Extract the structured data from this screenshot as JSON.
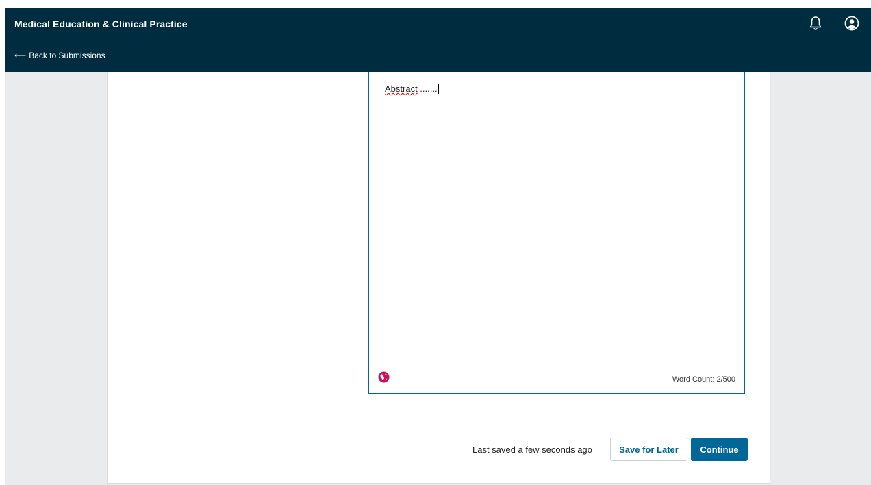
{
  "header": {
    "title": "Medical Education & Clinical Practice",
    "back_link": "Back to Submissions",
    "back_arrow": "⟵",
    "icons": [
      "bell-icon",
      "user-account-icon"
    ]
  },
  "editor": {
    "word": "Abstract",
    "trailing": " .......",
    "word_count": "Word Count: 2/500",
    "language_icon": "globe-icon",
    "accent_color": "#006798",
    "language_icon_color": "#c8125c"
  },
  "footer": {
    "status": "Last saved a few seconds ago",
    "save_later": "Save for Later",
    "continue": "Continue"
  },
  "colors": {
    "header_bg": "#002c40",
    "page_bg": "#e9ebed",
    "primary": "#006798"
  }
}
